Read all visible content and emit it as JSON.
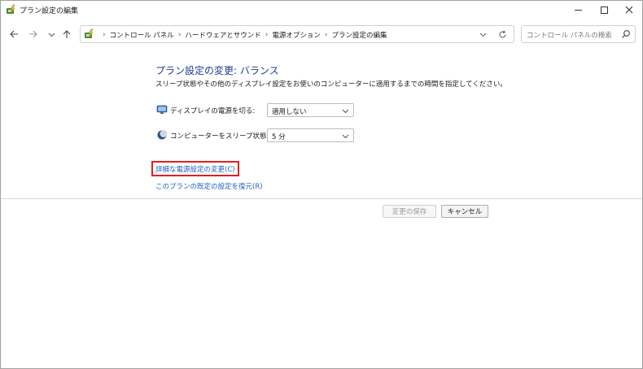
{
  "window": {
    "title": "プラン設定の編集"
  },
  "nav": {
    "breadcrumbs": [
      "コントロール パネル",
      "ハードウェアとサウンド",
      "電源オプション",
      "プラン設定の編集"
    ],
    "search_placeholder": "コントロール パネルの検索"
  },
  "content": {
    "heading": "プラン設定の変更: バランス",
    "description": "スリープ状態やその他のディスプレイ設定をお使いのコンピューターに適用するまでの時間を指定してください。",
    "display_off": {
      "label": "ディスプレイの電源を切る:",
      "value": "適用しない"
    },
    "sleep": {
      "label": "コンピューターをスリープ状態にする:",
      "value": "5 分"
    },
    "advanced_link": "詳細な電源設定の変更(C)",
    "restore_link": "このプランの既定の設定を復元(R)"
  },
  "buttons": {
    "save": "変更の保存",
    "cancel": "キャンセル"
  },
  "colors": {
    "heading": "#1e3d8f",
    "link": "#1f5fbf",
    "highlight": "#e0201c"
  },
  "icons": [
    "power-options-icon",
    "minimize-icon",
    "maximize-icon",
    "close-icon",
    "back-arrow-icon",
    "forward-arrow-icon",
    "chevron-down-icon",
    "up-arrow-icon",
    "refresh-icon",
    "search-icon",
    "monitor-icon",
    "moon-icon"
  ]
}
